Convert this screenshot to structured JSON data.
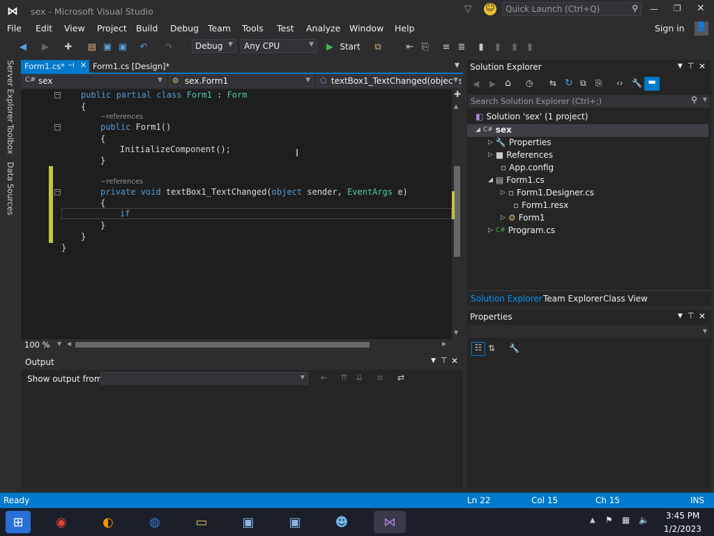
{
  "window": {
    "title": "sex - Microsoft Visual Studio",
    "quick_launch_placeholder": "Quick Launch (Ctrl+Q)"
  },
  "menu": [
    "File",
    "Edit",
    "View",
    "Project",
    "Build",
    "Debug",
    "Team",
    "Tools",
    "Test",
    "Analyze",
    "Window",
    "Help"
  ],
  "sign_in": "Sign in",
  "toolbar": {
    "config": "Debug",
    "platform": "Any CPU",
    "start": "Start"
  },
  "left_tabs": [
    "Server Explorer",
    "Toolbox",
    "Data Sources"
  ],
  "doc_tabs": [
    {
      "label": "Form1.cs*"
    },
    {
      "label": "Form1.cs [Design]*"
    }
  ],
  "nav": {
    "project": "sex",
    "class": "sex.Form1",
    "member": "textBox1_TextChanged(object se"
  },
  "code": {
    "l1_kw": "public partial class",
    "l1_name": "Form1",
    "l1_sep": ":",
    "l1_base": "Form",
    "brace_open": "{",
    "brace_close": "}",
    "refs": "references",
    "ctor_kw": "public",
    "ctor_name": "Form1()",
    "init_call": "InitializeComponent();",
    "m_kw": "private void",
    "m_name": "textBox1_TextChanged(",
    "m_p1": "object",
    "m_p1n": "sender,",
    "m_p2": "EventArgs",
    "m_p2n": "e)",
    "if_kw": "if"
  },
  "zoom": "100 %",
  "output": {
    "title": "Output",
    "show_from": "Show output from:"
  },
  "solution_explorer": {
    "title": "Solution Explorer",
    "search_placeholder": "Search Solution Explorer (Ctrl+;)",
    "solution": "Solution 'sex' (1 project)",
    "project": "sex",
    "items": [
      "Properties",
      "References",
      "App.config",
      "Form1.cs",
      "Form1.Designer.cs",
      "Form1.resx",
      "Form1",
      "Program.cs"
    ],
    "tabs": [
      "Solution Explorer",
      "Team Explorer",
      "Class View"
    ]
  },
  "properties": {
    "title": "Properties"
  },
  "status": {
    "ready": "Ready",
    "ln": "Ln 22",
    "col": "Col 15",
    "ch": "Ch 15",
    "mode": "INS"
  },
  "clock": {
    "time": "3:45 PM",
    "date": "1/2/2023"
  },
  "colors": {
    "accent": "#007acc",
    "keyword": "#569cd6",
    "type": "#4ec9b0",
    "bg": "#1e1e1e"
  }
}
